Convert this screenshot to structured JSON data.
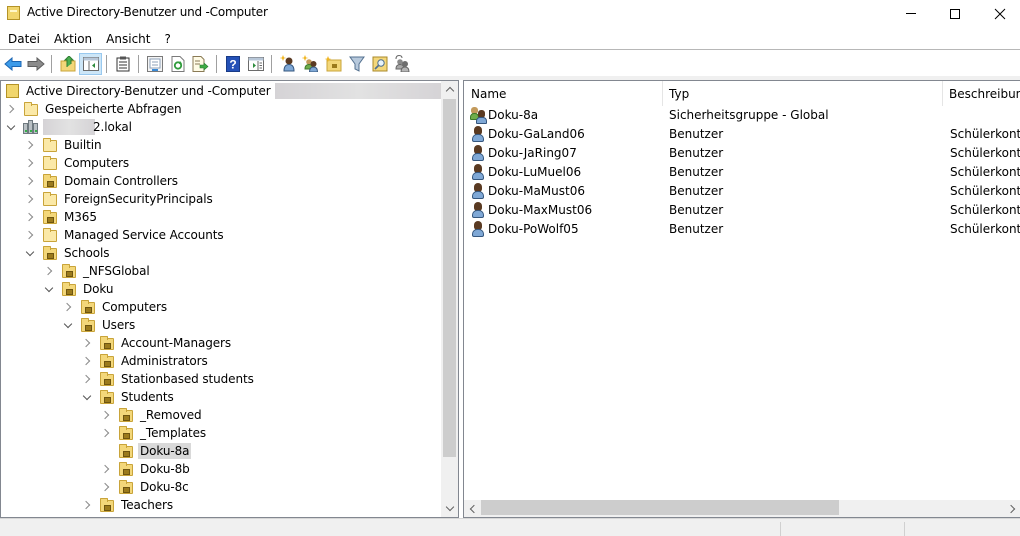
{
  "window": {
    "title": "Active Directory-Benutzer und -Computer",
    "controls": {
      "minimize": "minimize",
      "maximize": "maximize",
      "close": "close"
    }
  },
  "menu": {
    "items": [
      "Datei",
      "Aktion",
      "Ansicht",
      "?"
    ]
  },
  "toolbar": {
    "buttons": [
      {
        "icon": "back-arrow-icon",
        "label": "Zurück"
      },
      {
        "icon": "forward-arrow-icon",
        "label": "Vor"
      },
      {
        "icon": "up-folder-icon",
        "label": "Übergeordnete Ebene"
      },
      {
        "icon": "show-hide-console-tree-icon",
        "label": "Konsolenstruktur ein/aus",
        "pressed": true
      },
      {
        "icon": "clipboard-icon",
        "label": "Eigenschaften"
      },
      {
        "icon": "list-view-icon",
        "label": "Liste"
      },
      {
        "icon": "refresh-icon",
        "label": "Aktualisieren"
      },
      {
        "icon": "export-list-icon",
        "label": "Liste exportieren"
      },
      {
        "icon": "help-icon",
        "label": "Hilfe"
      },
      {
        "icon": "show-action-pane-icon",
        "label": "Aktionsbereich"
      },
      {
        "icon": "new-user-icon",
        "label": "Neuer Benutzer"
      },
      {
        "icon": "new-group-icon",
        "label": "Neue Gruppe"
      },
      {
        "icon": "new-ou-icon",
        "label": "Neue Organisationseinheit"
      },
      {
        "icon": "filter-icon",
        "label": "Filter"
      },
      {
        "icon": "find-icon",
        "label": "Suchen"
      },
      {
        "icon": "add-to-group-icon",
        "label": "Zu Gruppe hinzufügen"
      }
    ]
  },
  "tree": {
    "root": {
      "label": "Active Directory-Benutzer und -Computer",
      "redacted": true
    },
    "nodes": [
      {
        "label": "Gespeicherte Abfragen",
        "level": 1,
        "state": "collapsed",
        "icon": "folder"
      },
      {
        "label": "2.lokal",
        "level": 1,
        "state": "expanded",
        "icon": "domain",
        "redacted_prefix": true
      },
      {
        "label": "Builtin",
        "level": 2,
        "state": "collapsed",
        "icon": "folder"
      },
      {
        "label": "Computers",
        "level": 2,
        "state": "collapsed",
        "icon": "folder"
      },
      {
        "label": "Domain Controllers",
        "level": 2,
        "state": "collapsed",
        "icon": "ou"
      },
      {
        "label": "ForeignSecurityPrincipals",
        "level": 2,
        "state": "collapsed",
        "icon": "folder"
      },
      {
        "label": "M365",
        "level": 2,
        "state": "collapsed",
        "icon": "ou"
      },
      {
        "label": "Managed Service Accounts",
        "level": 2,
        "state": "collapsed",
        "icon": "folder"
      },
      {
        "label": "Schools",
        "level": 2,
        "state": "expanded",
        "icon": "ou"
      },
      {
        "label": "_NFSGlobal",
        "level": 3,
        "state": "collapsed",
        "icon": "ou"
      },
      {
        "label": "Doku",
        "level": 3,
        "state": "expanded",
        "icon": "ou"
      },
      {
        "label": "Computers",
        "level": 4,
        "state": "collapsed",
        "icon": "ou"
      },
      {
        "label": "Users",
        "level": 4,
        "state": "expanded",
        "icon": "ou"
      },
      {
        "label": "Account-Managers",
        "level": 5,
        "state": "collapsed",
        "icon": "ou"
      },
      {
        "label": "Administrators",
        "level": 5,
        "state": "collapsed",
        "icon": "ou"
      },
      {
        "label": "Stationbased students",
        "level": 5,
        "state": "collapsed",
        "icon": "ou"
      },
      {
        "label": "Students",
        "level": 5,
        "state": "expanded",
        "icon": "ou"
      },
      {
        "label": "_Removed",
        "level": 6,
        "state": "collapsed",
        "icon": "ou"
      },
      {
        "label": "_Templates",
        "level": 6,
        "state": "collapsed",
        "icon": "ou"
      },
      {
        "label": "Doku-8a",
        "level": 6,
        "state": "leaf",
        "icon": "ou",
        "selected": true
      },
      {
        "label": "Doku-8b",
        "level": 6,
        "state": "collapsed",
        "icon": "ou"
      },
      {
        "label": "Doku-8c",
        "level": 6,
        "state": "collapsed",
        "icon": "ou"
      },
      {
        "label": "Teachers",
        "level": 5,
        "state": "collapsed",
        "icon": "ou"
      }
    ]
  },
  "list": {
    "columns": [
      "Name",
      "Typ",
      "Beschreibung"
    ],
    "rows": [
      {
        "icon": "group",
        "name": "Doku-8a",
        "type": "Sicherheitsgruppe - Global",
        "description": ""
      },
      {
        "icon": "user",
        "name": "Doku-GaLand06",
        "type": "Benutzer",
        "description": "Schülerkonto"
      },
      {
        "icon": "user",
        "name": "Doku-JaRing07",
        "type": "Benutzer",
        "description": "Schülerkonto"
      },
      {
        "icon": "user",
        "name": "Doku-LuMuel06",
        "type": "Benutzer",
        "description": "Schülerkonto"
      },
      {
        "icon": "user",
        "name": "Doku-MaMust06",
        "type": "Benutzer",
        "description": "Schülerkonto"
      },
      {
        "icon": "user",
        "name": "Doku-MaxMust06",
        "type": "Benutzer",
        "description": "Schülerkonto"
      },
      {
        "icon": "user",
        "name": "Doku-PoWolf05",
        "type": "Benutzer",
        "description": "Schülerkonto"
      }
    ]
  },
  "colors": {
    "selection": "#d9d9d9",
    "toolbar_pressed": "#cde6f7",
    "folder": "#f3d77a",
    "border": "#828790"
  }
}
